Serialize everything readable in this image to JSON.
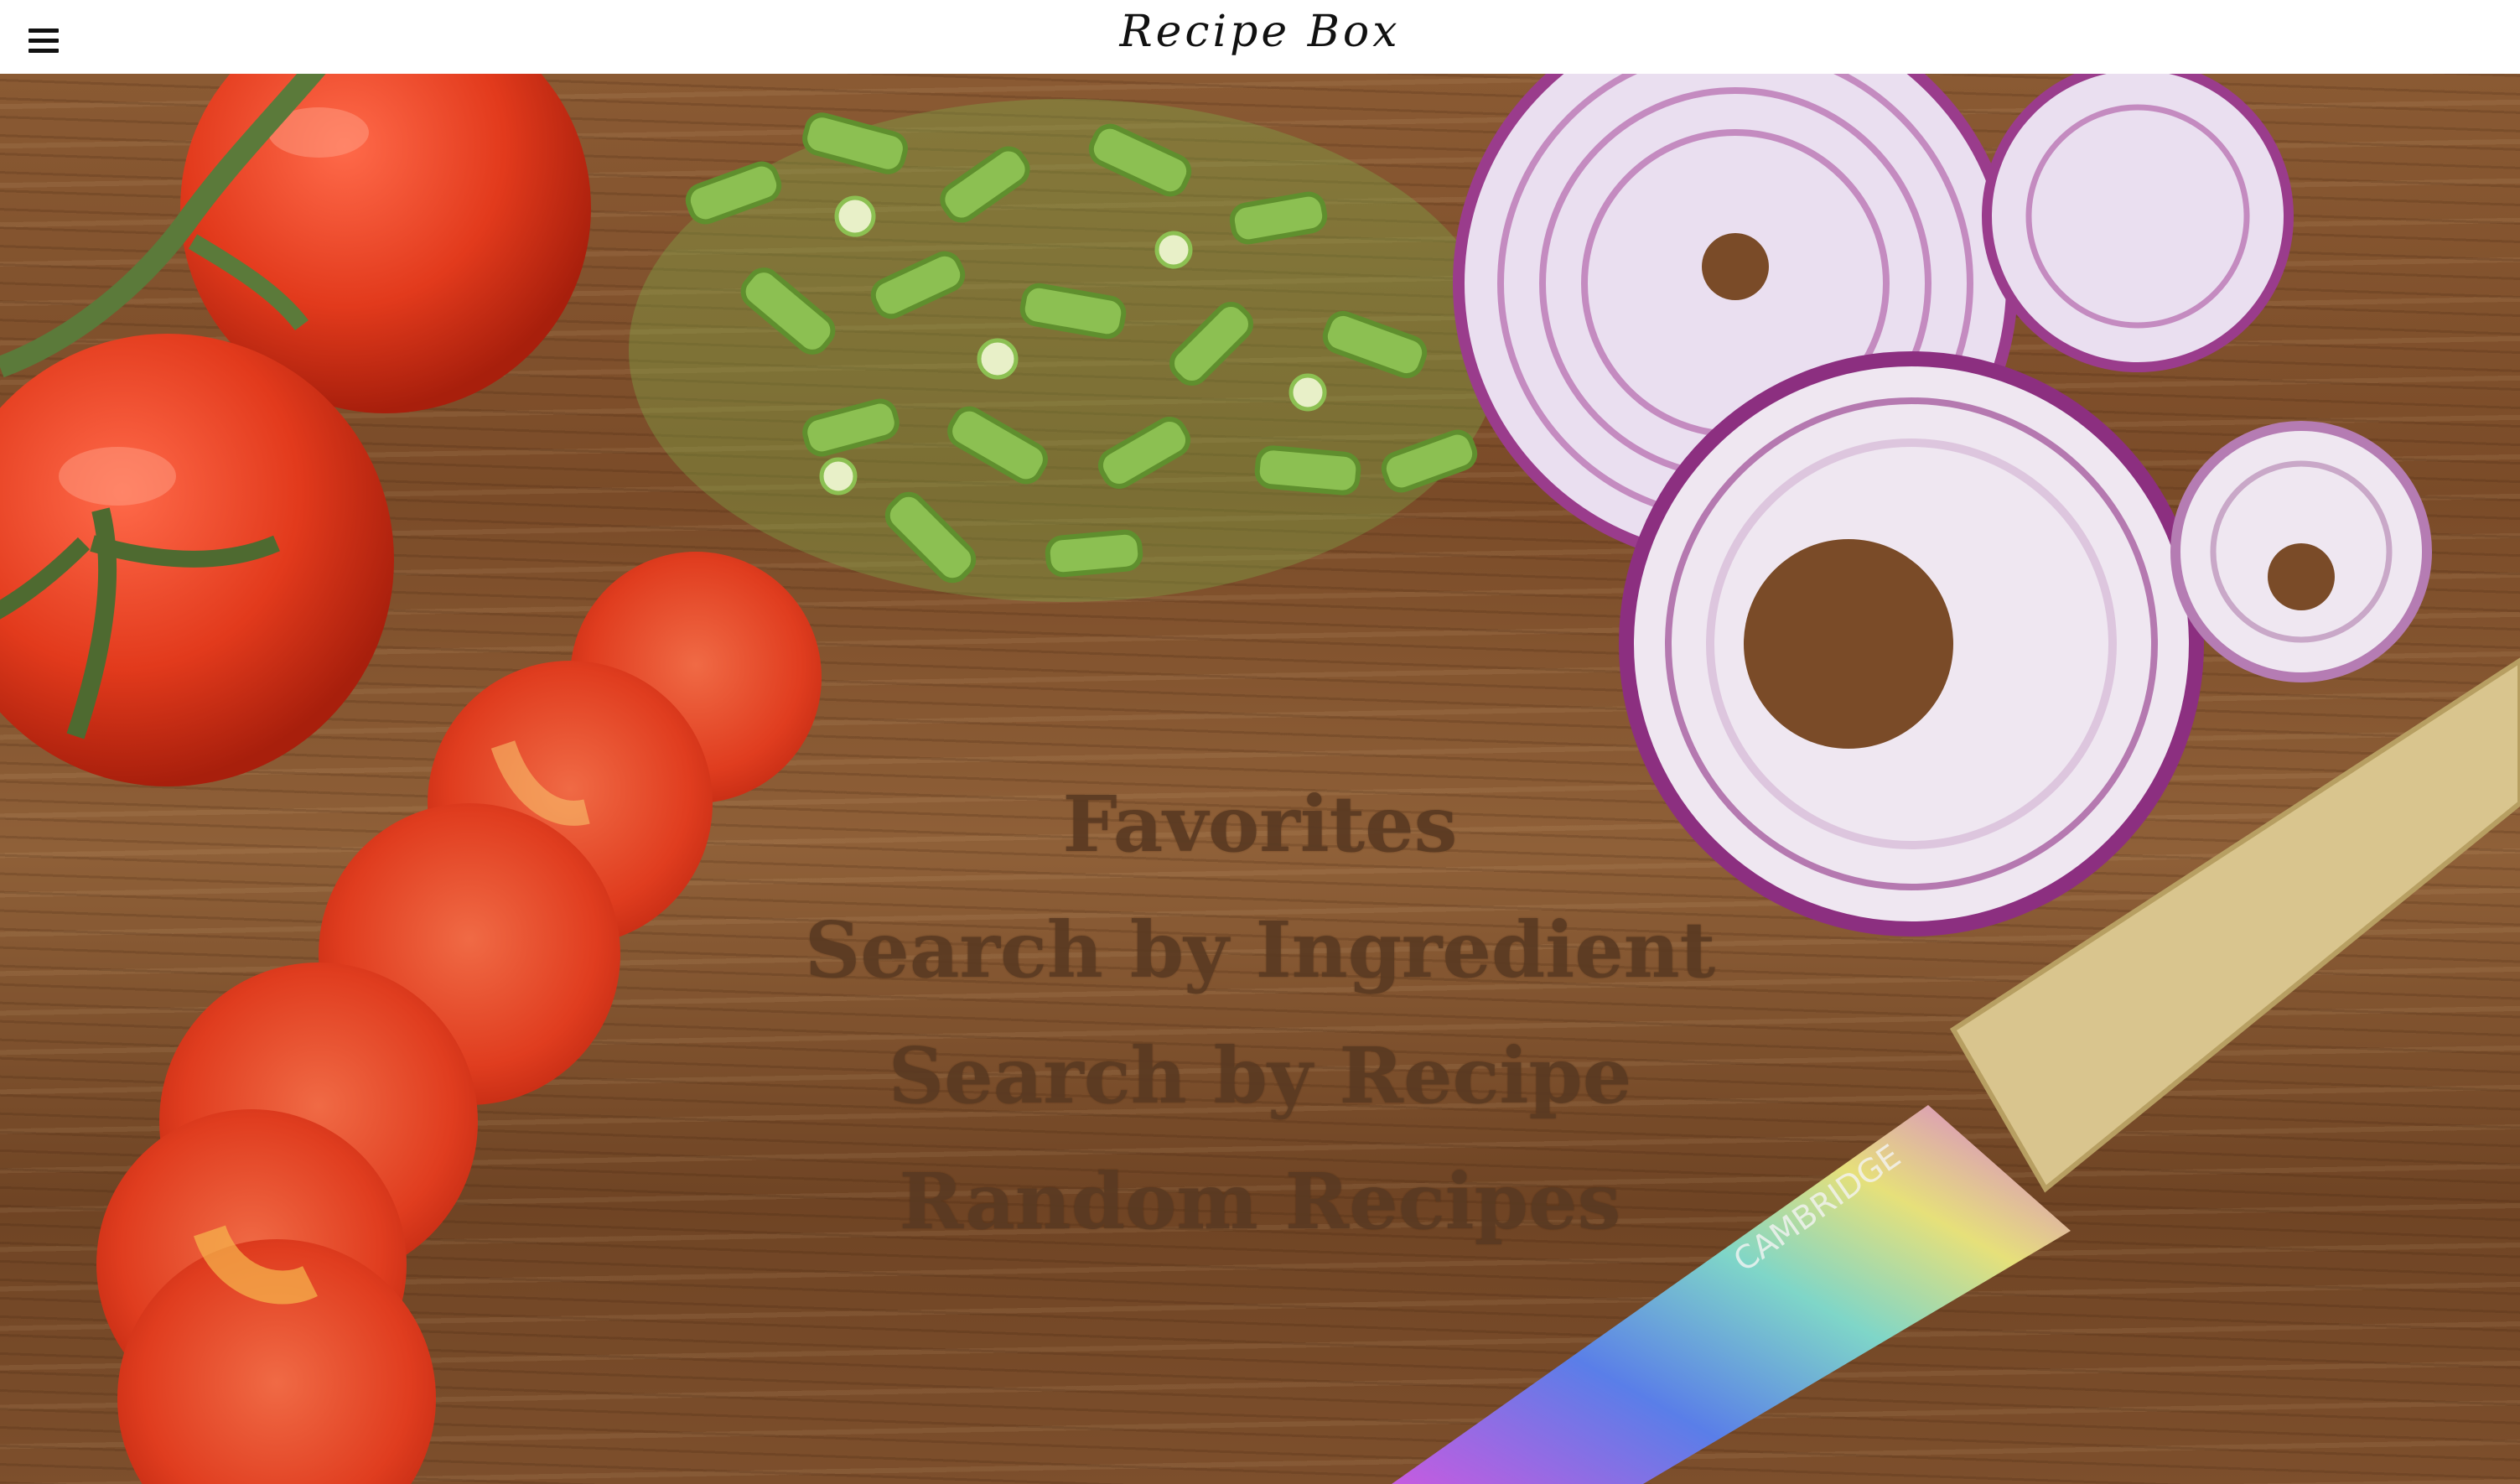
{
  "header": {
    "title": "Recipe Box",
    "menu_icon": "hamburger-menu-icon"
  },
  "hero": {
    "background": "wooden cutting board with tomatoes, green onions, red onion slices and a knife",
    "knife_brand": "CAMBRIDGE"
  },
  "nav": {
    "items": [
      {
        "label": "Favorites"
      },
      {
        "label": "Search by Ingredient"
      },
      {
        "label": "Search by Recipe"
      },
      {
        "label": "Random Recipes"
      }
    ]
  },
  "colors": {
    "menu_text": "#5a3a22",
    "topbar_bg": "#ffffff",
    "wood": "#7a4b28"
  }
}
